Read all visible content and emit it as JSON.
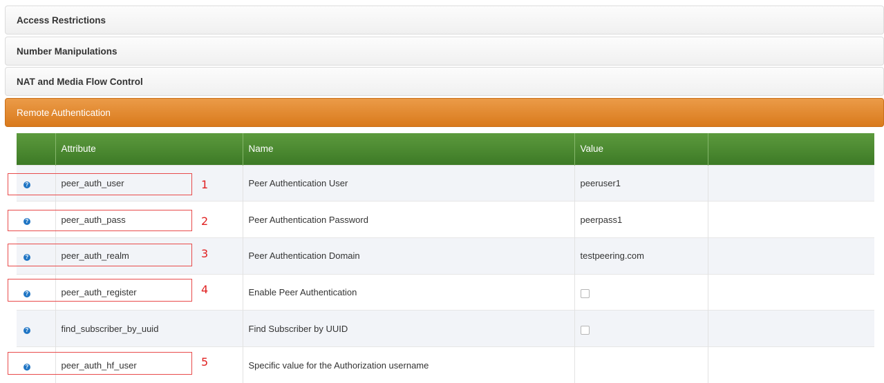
{
  "accordions": [
    {
      "label": "Access Restrictions"
    },
    {
      "label": "Number Manipulations"
    },
    {
      "label": "NAT and Media Flow Control"
    },
    {
      "label": "Remote Authentication"
    }
  ],
  "table": {
    "headers": [
      "",
      "Attribute",
      "Name",
      "Value",
      ""
    ],
    "rows": [
      {
        "attribute": "peer_auth_user",
        "name": "Peer Authentication User",
        "value": "peeruser1",
        "type": "text"
      },
      {
        "attribute": "peer_auth_pass",
        "name": "Peer Authentication Password",
        "value": "peerpass1",
        "type": "text"
      },
      {
        "attribute": "peer_auth_realm",
        "name": "Peer Authentication Domain",
        "value": "testpeering.com",
        "type": "text"
      },
      {
        "attribute": "peer_auth_register",
        "name": "Enable Peer Authentication",
        "value": "",
        "type": "checkbox",
        "checked": false
      },
      {
        "attribute": "find_subscriber_by_uuid",
        "name": "Find Subscriber by UUID",
        "value": "",
        "type": "checkbox",
        "checked": false
      },
      {
        "attribute": "peer_auth_hf_user",
        "name": "Specific value for the Authorization username",
        "value": "",
        "type": "text"
      }
    ],
    "help_icon_glyph": "?"
  },
  "annotations": [
    "1",
    "2",
    "3",
    "4",
    "5"
  ],
  "colors": {
    "active_accordion": "#d97a1c",
    "table_header": "#3d7a26",
    "annotation_red": "#e02020",
    "help_icon": "#1f75c4"
  }
}
